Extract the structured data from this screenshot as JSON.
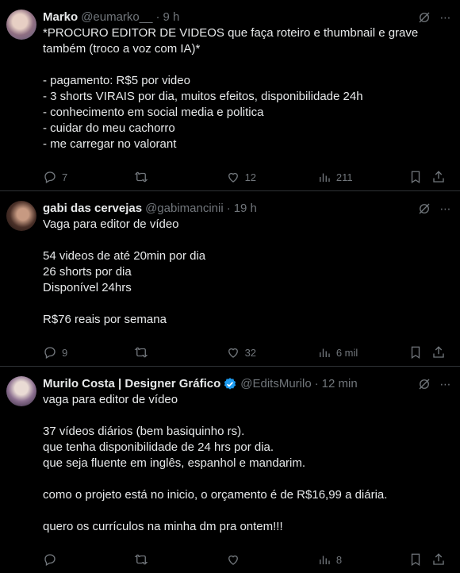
{
  "tweets": [
    {
      "name": "Marko",
      "handle": "@eumarko__",
      "dot": "·",
      "time": "9 h",
      "text": "*PROCURO EDITOR DE VIDEOS que faça roteiro e thumbnail e grave também (troco a voz com IA)*\n\n- pagamento: R$5 por video\n- 3 shorts VIRAIS por dia, muitos efeitos, disponibilidade 24h\n- conhecimento em social media e politica\n- cuidar do meu cachorro\n- me carregar no valorant",
      "replies": "7",
      "retweets": "",
      "likes": "12",
      "views": "211",
      "verified": false
    },
    {
      "name": "gabi das cervejas",
      "handle": "@gabimancinii",
      "dot": "·",
      "time": "19 h",
      "text": "Vaga para editor de vídeo\n\n54 videos de até 20min por dia\n26 shorts por dia\nDisponível 24hrs\n\nR$76 reais por semana",
      "replies": "9",
      "retweets": "",
      "likes": "32",
      "views": "6 mil",
      "verified": false
    },
    {
      "name": "Murilo Costa | Designer Gráfico",
      "handle": "@EditsMurilo",
      "dot": "·",
      "time": "12 min",
      "text": "vaga para editor de vídeo\n\n37 vídeos diários (bem basiquinho rs).\nque tenha disponibilidade de 24 hrs por dia.\nque seja fluente em inglês, espanhol e mandarim.\n\ncomo o projeto está no inicio, o orçamento é de R$16,99 a diária.\n\nquero os currículos na minha dm pra ontem!!!",
      "replies": "",
      "retweets": "",
      "likes": "",
      "views": "8",
      "verified": true
    }
  ],
  "icons": {
    "more": "more-icon",
    "grok": "grok-icon",
    "reply": "reply-icon",
    "retweet": "retweet-icon",
    "like": "like-icon",
    "views": "views-icon",
    "bookmark": "bookmark-icon",
    "share": "share-icon",
    "verified": "verified-badge-icon"
  },
  "colors": {
    "background": "#000000",
    "text": "#e7e9ea",
    "muted": "#71767b",
    "border": "#2f3336",
    "verified": "#1d9bf0"
  }
}
